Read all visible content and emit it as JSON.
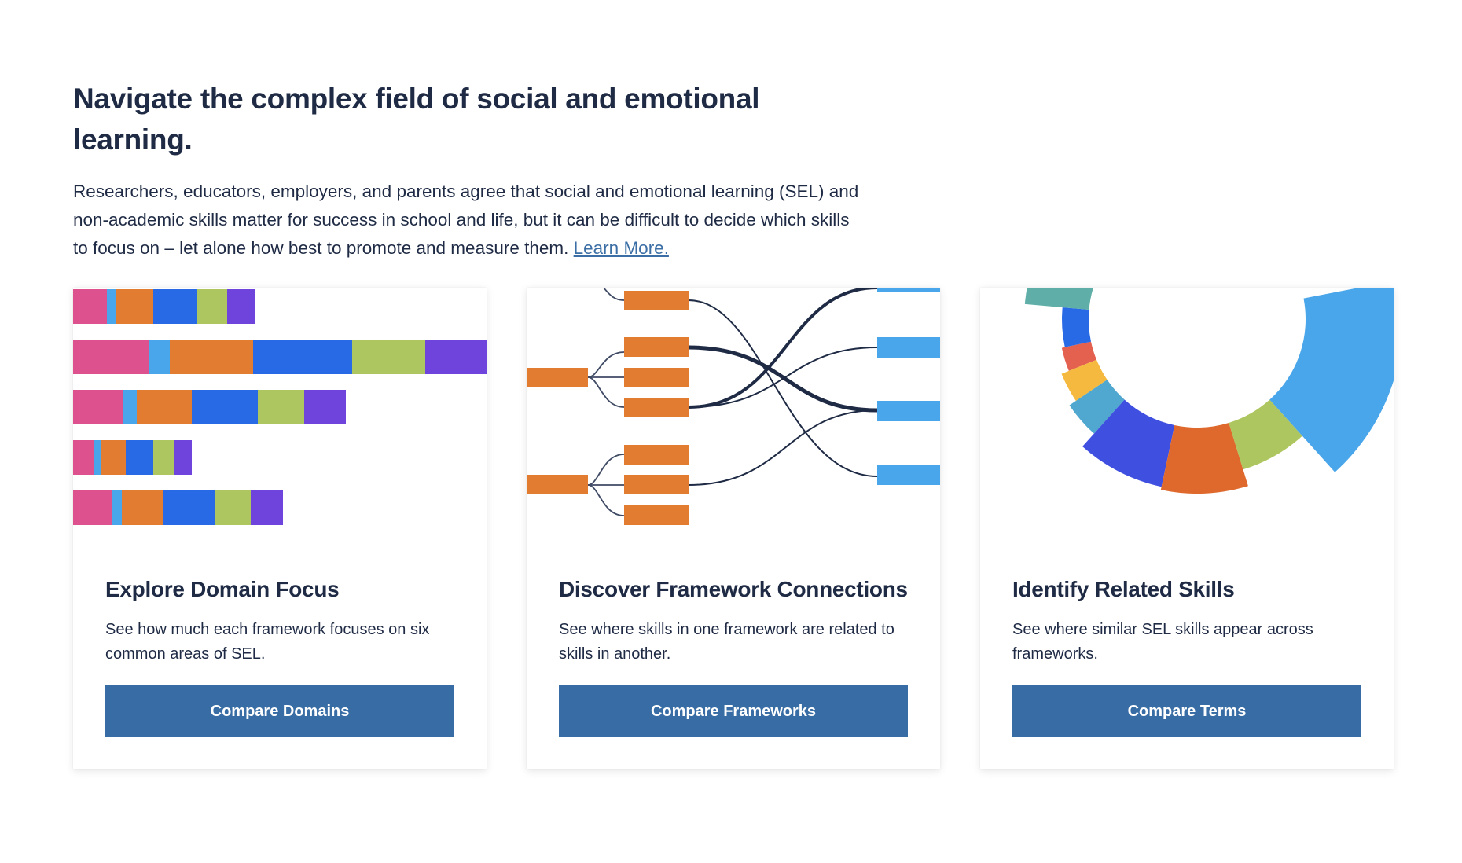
{
  "intro": {
    "headline": "Navigate the complex field of social and emotional learning.",
    "paragraph": "Researchers, educators, employers, and parents agree that social and emotional learning (SEL) and non-academic skills matter for success in school and life, but it can be difficult to decide which skills to focus on – let alone how best to promote and measure them.",
    "link_label": "Learn More."
  },
  "colors": {
    "text": "#1f2b45",
    "button": "#386ca4",
    "link": "#3a6ea5",
    "domain_palette": [
      "#dc518e",
      "#4aa6ea",
      "#e17c31",
      "#2869e6",
      "#aec65f",
      "#6e44dc"
    ],
    "connector_box": "#e17c31",
    "target_box": "#4aa6ea",
    "line": "#1f2b45"
  },
  "cards": [
    {
      "title": "Explore Domain Focus",
      "description": "See how much each framework focuses on six common areas of SEL.",
      "button_label": "Compare Domains",
      "illustration": "stacked-bars"
    },
    {
      "title": "Discover Framework Connections",
      "description": "See where skills in one framework are related to skills in another.",
      "button_label": "Compare Frameworks",
      "illustration": "connection-diagram"
    },
    {
      "title": "Identify Related Skills",
      "description": "See where similar SEL skills appear across frameworks.",
      "button_label": "Compare Terms",
      "illustration": "radial-chart"
    }
  ]
}
